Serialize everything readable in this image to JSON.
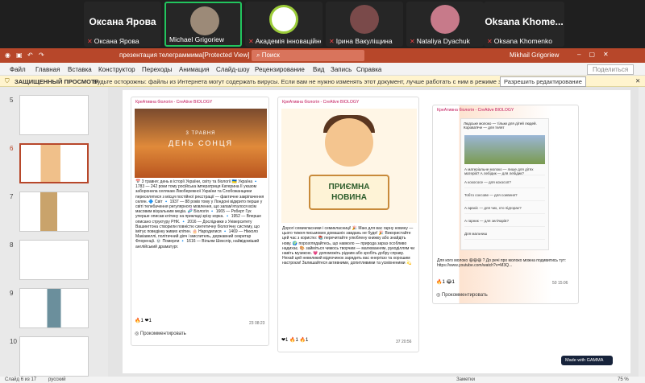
{
  "zoom": {
    "participants": [
      {
        "big": "Оксана Ярова",
        "name": "Оксана Ярова",
        "muted": true
      },
      {
        "big": "",
        "name": "Michael Grigoriew",
        "muted": false,
        "active": true
      },
      {
        "big": "",
        "name": "Академія інноваційно...",
        "muted": true
      },
      {
        "big": "",
        "name": "Ірина Вакуліщина",
        "muted": true
      },
      {
        "big": "",
        "name": "Nataliya Dyachuk",
        "muted": true
      },
      {
        "big": "Oksana  Khome...",
        "name": "Oksana Khomenko",
        "muted": true
      }
    ]
  },
  "ppt": {
    "title": "презентация телеграммима[Protected View]  -  PowerPoint",
    "search_placeholder": "Поиск",
    "user": "Mikhail Grigoriew",
    "menu": [
      "Файл",
      "Главная",
      "Вставка",
      "Конструктор",
      "Переходы",
      "Анимация",
      "Слайд-шоу",
      "Рецензирование",
      "Вид",
      "Запись",
      "Справка"
    ],
    "share": "Поделиться",
    "protected_label": "ЗАЩИЩЕННЫЙ ПРОСМОТР",
    "protected_msg": "Будьте осторожны: файлы из Интернета могут содержать вирусы. Если вам не нужно изменять этот документ, лучше работать с ним в режиме защищенного просмотра.",
    "enable_edit": "Разрешить редактирование",
    "slide_numbers": [
      "5",
      "6",
      "7",
      "8",
      "9",
      "10"
    ]
  },
  "slide": {
    "channel": "КреАтивна біологія - CreAtive BIOLOGY",
    "card1": {
      "img_l1": "3 ТРАВНЯ",
      "img_l2": "ДЕНЬ СОНЦЯ",
      "text": "📅 3 травня: день в історії України, світу та біології 🇺🇦 Україна 🔹 1783 — 242 роки тому російська імператриця Катерина II указом заборонила селянам Лівобережної України та Слобожанщини переселятися з місця постійної реєстрації — фактичне закріпачення селян. 🔷 Світ 🔹 1937 — 88 років тому у Лондоні відкрито перше у світі телебачення регулярного мовлення, що запам'яталося всім масовим візуальним медіа. 🧬 Біологія 🔹 1665 — Роберт Гук уперше описав клітину на прикладі зрізу корка. 🔹 1952 — Вперше описано структуру РНК. 🔹 2016 — Дослідники з Університету Вашингтона створили повністю синтетичну біологічну систему, що імітує поведінку живих клітин. 🎂 Народилися 🔹 1469 — Нікколо Макіавеллі, політичний діяч і мислитель, державний секретар Флоренції. 💀 Померли 🔹 1616 — Вільям Шекспір, найвідоміший англійський драматург.",
      "reactions": "🔥1  ❤1",
      "time": "23  08:23",
      "comment": "Прокомментировать"
    },
    "card2": {
      "sign": "ПРИЄМНА НОВИНА",
      "text": "Дорогі семикласники і семикласниці! 🎉 Маю для вас гарну новину — цього тижня письмових домашніх завдань не буде! 🎉 Використайте цей час з користю: 📚 перечитайте улюблену книжку або знайдіть нову. 🌍 порозглядайтесь, що навколо — природа зараз особливо надихає. 🎨 займіться чимось творчим — малюванням, рукоділлям чи навіть музикою. 💗 допоможіть рідним або зробіть добру справу. Нехай цей невеликий відпочинок зарядить вас енергією та хорошим настроєм! Залишайтеся активними, допитливими та усміхненими 💫",
      "reactions": "❤1  🔥1  🔥1",
      "time": "37  20:56"
    },
    "card3": {
      "post": "Людське молоко — тільки для дітей людей. Корова'яче — для телят",
      "rows": [
        "А матеріальне молоко — лише для дітях матерів? А лебідик — для лебідик?",
        "А кохососе — для кохосоп?",
        "Тобто соєсове — для соевеня?",
        "А арахіс — для чих, хто підгорає?",
        "А гарник — для зелічарів?",
        "Для мальчиш"
      ],
      "text": "Для кого молоко 😄😄😄 ? До речі про молоко можна подивитись тут: https://www.youtube.com/watch?v=M3Q...",
      "reactions": "🔥1  😂1",
      "time": "50  15:06",
      "comment": "Прокомментировать"
    },
    "gamma": "Made with GAMMA"
  },
  "status": {
    "slide_info": "Слайд 6 из 17",
    "lang": "русский",
    "notes": "Заметки",
    "zoom_pct": "75 %"
  }
}
